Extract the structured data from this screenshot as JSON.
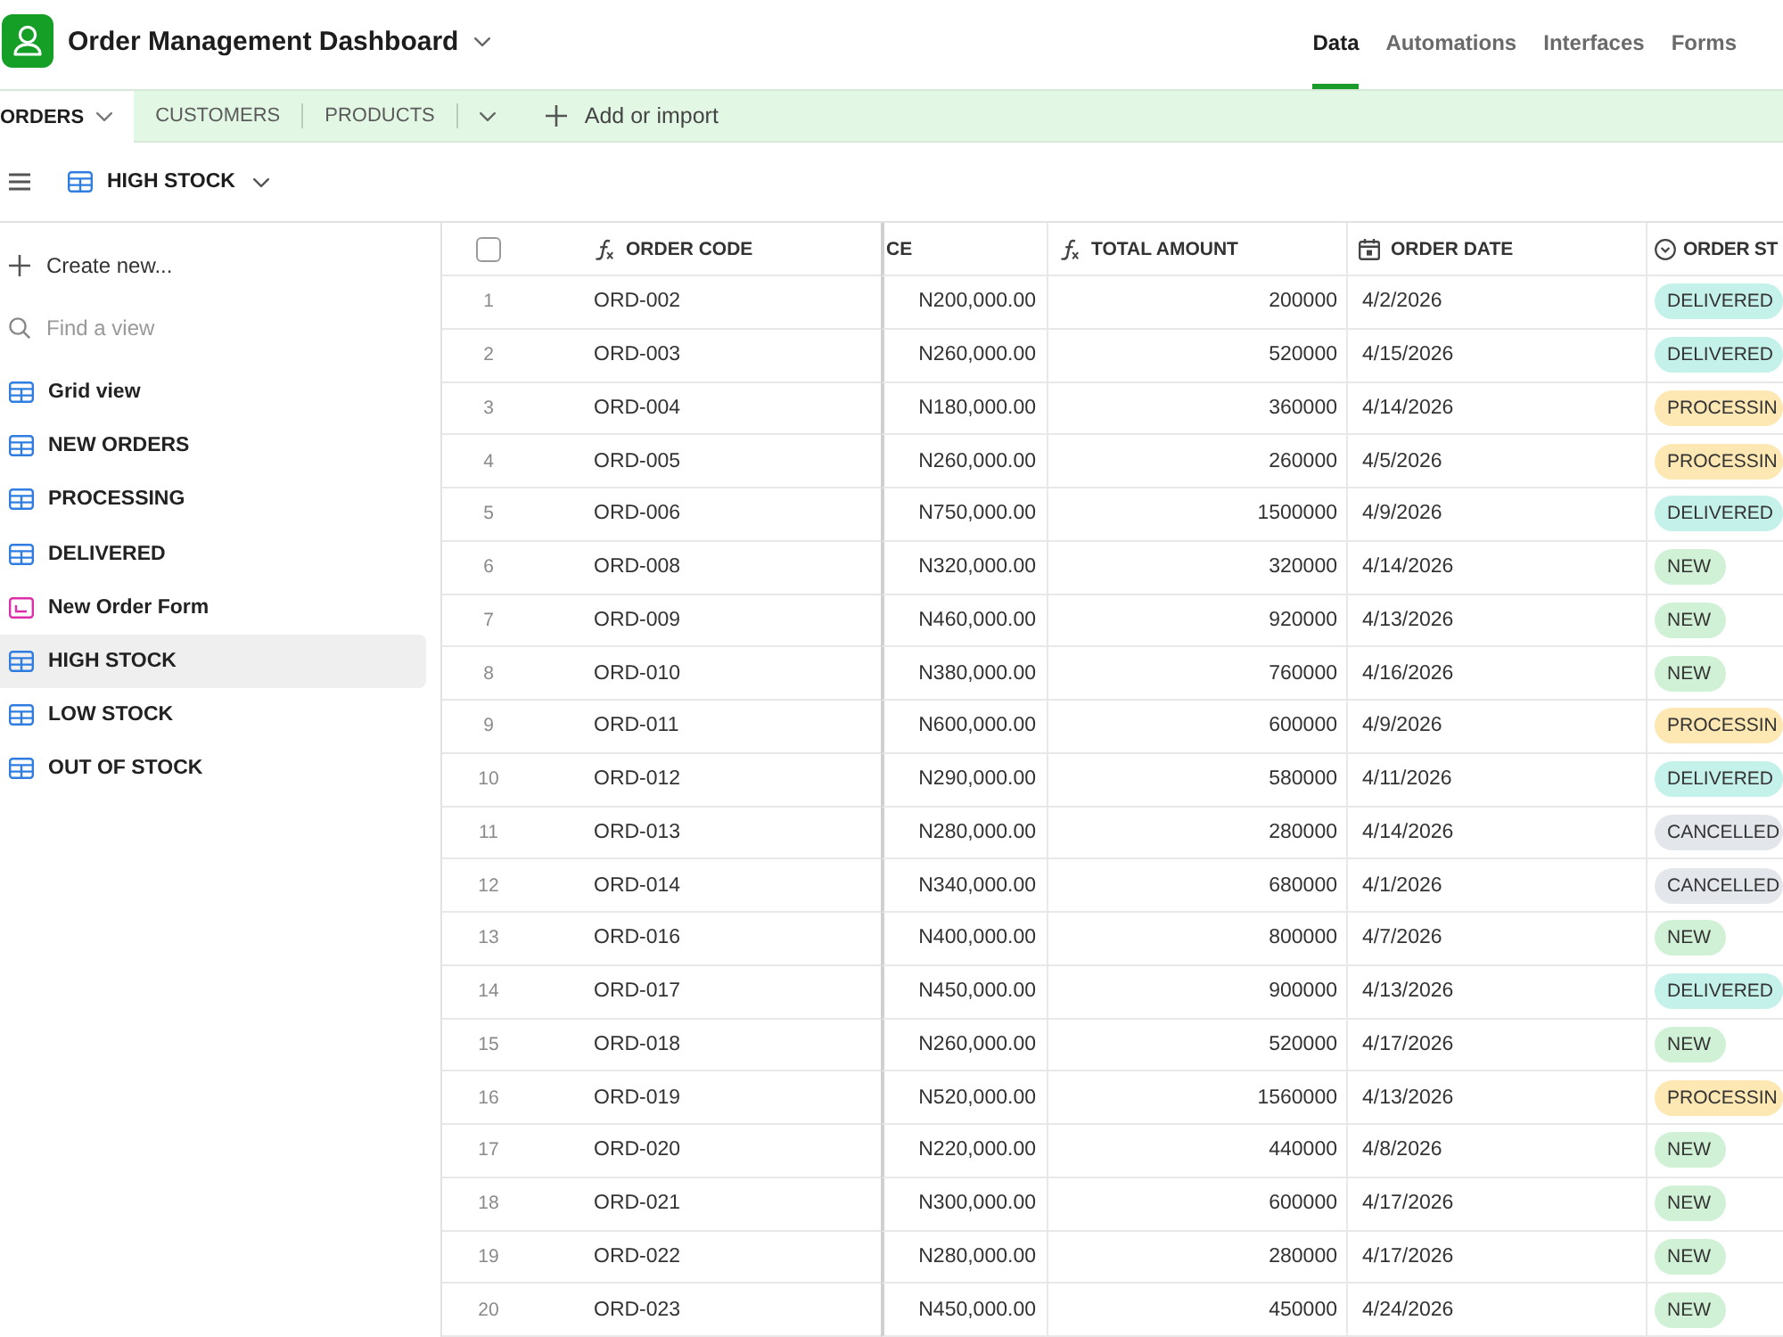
{
  "app": {
    "title": "Order Management Dashboard"
  },
  "nav": [
    {
      "label": "Data",
      "selected": true
    },
    {
      "label": "Automations",
      "selected": false
    },
    {
      "label": "Interfaces",
      "selected": false
    },
    {
      "label": "Forms",
      "selected": false
    }
  ],
  "table_tabs": {
    "tabs": [
      {
        "label": "ORDERS",
        "selected": true
      },
      {
        "label": "CUSTOMERS",
        "selected": false
      },
      {
        "label": "PRODUCTS",
        "selected": false
      }
    ],
    "add_button": "Add or import"
  },
  "view_bar": {
    "view_name": "HIGH STOCK"
  },
  "sidebar": {
    "create_button": "Create new...",
    "search": {
      "placeholder": "Find a view"
    },
    "items": [
      {
        "label": "Grid view",
        "kind": "grid",
        "selected": false
      },
      {
        "label": "NEW ORDERS",
        "kind": "grid",
        "selected": false
      },
      {
        "label": "PROCESSING",
        "kind": "grid",
        "selected": false
      },
      {
        "label": "DELIVERED",
        "kind": "grid",
        "selected": false
      },
      {
        "label": "New Order Form",
        "kind": "form",
        "selected": false
      },
      {
        "label": "HIGH STOCK",
        "kind": "grid",
        "selected": true
      },
      {
        "label": "LOW STOCK",
        "kind": "grid",
        "selected": false
      },
      {
        "label": "OUT OF STOCK",
        "kind": "grid",
        "selected": false
      }
    ]
  },
  "grid": {
    "select_all": {
      "checked": false
    },
    "columns": [
      {
        "label": "ORDER CODE",
        "kind": "formula"
      },
      {
        "label": "CE",
        "kind": "none"
      },
      {
        "label": "TOTAL AMOUNT",
        "kind": "formula"
      },
      {
        "label": "ORDER DATE",
        "kind": "date"
      },
      {
        "label": "ORDER ST",
        "kind": "select"
      }
    ],
    "rows": [
      {
        "number": "1",
        "order_code": "ORD-002",
        "column_2": "N200,000.00",
        "total_amount": "200000",
        "order_date": "4/2/2026",
        "order_status": {
          "label": "DELIVERED",
          "color": "#c5f1eb"
        }
      },
      {
        "number": "2",
        "order_code": "ORD-003",
        "column_2": "N260,000.00",
        "total_amount": "520000",
        "order_date": "4/15/2026",
        "order_status": {
          "label": "DELIVERED",
          "color": "#c5f1eb"
        }
      },
      {
        "number": "3",
        "order_code": "ORD-004",
        "column_2": "N180,000.00",
        "total_amount": "360000",
        "order_date": "4/14/2026",
        "order_status": {
          "label": "PROCESSIN",
          "color": "#fde7b3"
        }
      },
      {
        "number": "4",
        "order_code": "ORD-005",
        "column_2": "N260,000.00",
        "total_amount": "260000",
        "order_date": "4/5/2026",
        "order_status": {
          "label": "PROCESSIN",
          "color": "#fde7b3"
        }
      },
      {
        "number": "5",
        "order_code": "ORD-006",
        "column_2": "N750,000.00",
        "total_amount": "1500000",
        "order_date": "4/9/2026",
        "order_status": {
          "label": "DELIVERED",
          "color": "#c5f1eb"
        }
      },
      {
        "number": "6",
        "order_code": "ORD-008",
        "column_2": "N320,000.00",
        "total_amount": "320000",
        "order_date": "4/14/2026",
        "order_status": {
          "label": "NEW",
          "color": "#d0f1d5"
        }
      },
      {
        "number": "7",
        "order_code": "ORD-009",
        "column_2": "N460,000.00",
        "total_amount": "920000",
        "order_date": "4/13/2026",
        "order_status": {
          "label": "NEW",
          "color": "#d0f1d5"
        }
      },
      {
        "number": "8",
        "order_code": "ORD-010",
        "column_2": "N380,000.00",
        "total_amount": "760000",
        "order_date": "4/16/2026",
        "order_status": {
          "label": "NEW",
          "color": "#d0f1d5"
        }
      },
      {
        "number": "9",
        "order_code": "ORD-011",
        "column_2": "N600,000.00",
        "total_amount": "600000",
        "order_date": "4/9/2026",
        "order_status": {
          "label": "PROCESSIN",
          "color": "#fde7b3"
        }
      },
      {
        "number": "10",
        "order_code": "ORD-012",
        "column_2": "N290,000.00",
        "total_amount": "580000",
        "order_date": "4/11/2026",
        "order_status": {
          "label": "DELIVERED",
          "color": "#c5f1eb"
        }
      },
      {
        "number": "11",
        "order_code": "ORD-013",
        "column_2": "N280,000.00",
        "total_amount": "280000",
        "order_date": "4/14/2026",
        "order_status": {
          "label": "CANCELLED",
          "color": "#e3e6ea"
        }
      },
      {
        "number": "12",
        "order_code": "ORD-014",
        "column_2": "N340,000.00",
        "total_amount": "680000",
        "order_date": "4/1/2026",
        "order_status": {
          "label": "CANCELLED",
          "color": "#e3e6ea"
        }
      },
      {
        "number": "13",
        "order_code": "ORD-016",
        "column_2": "N400,000.00",
        "total_amount": "800000",
        "order_date": "4/7/2026",
        "order_status": {
          "label": "NEW",
          "color": "#d0f1d5"
        }
      },
      {
        "number": "14",
        "order_code": "ORD-017",
        "column_2": "N450,000.00",
        "total_amount": "900000",
        "order_date": "4/13/2026",
        "order_status": {
          "label": "DELIVERED",
          "color": "#c5f1eb"
        }
      },
      {
        "number": "15",
        "order_code": "ORD-018",
        "column_2": "N260,000.00",
        "total_amount": "520000",
        "order_date": "4/17/2026",
        "order_status": {
          "label": "NEW",
          "color": "#d0f1d5"
        }
      },
      {
        "number": "16",
        "order_code": "ORD-019",
        "column_2": "N520,000.00",
        "total_amount": "1560000",
        "order_date": "4/13/2026",
        "order_status": {
          "label": "PROCESSIN",
          "color": "#fde7b3"
        }
      },
      {
        "number": "17",
        "order_code": "ORD-020",
        "column_2": "N220,000.00",
        "total_amount": "440000",
        "order_date": "4/8/2026",
        "order_status": {
          "label": "NEW",
          "color": "#d0f1d5"
        }
      },
      {
        "number": "18",
        "order_code": "ORD-021",
        "column_2": "N300,000.00",
        "total_amount": "600000",
        "order_date": "4/17/2026",
        "order_status": {
          "label": "NEW",
          "color": "#d0f1d5"
        }
      },
      {
        "number": "19",
        "order_code": "ORD-022",
        "column_2": "N280,000.00",
        "total_amount": "280000",
        "order_date": "4/17/2026",
        "order_status": {
          "label": "NEW",
          "color": "#d0f1d5"
        }
      },
      {
        "number": "20",
        "order_code": "ORD-023",
        "column_2": "N450,000.00",
        "total_amount": "450000",
        "order_date": "4/24/2026",
        "order_status": {
          "label": "NEW",
          "color": "#d0f1d5"
        }
      }
    ]
  }
}
